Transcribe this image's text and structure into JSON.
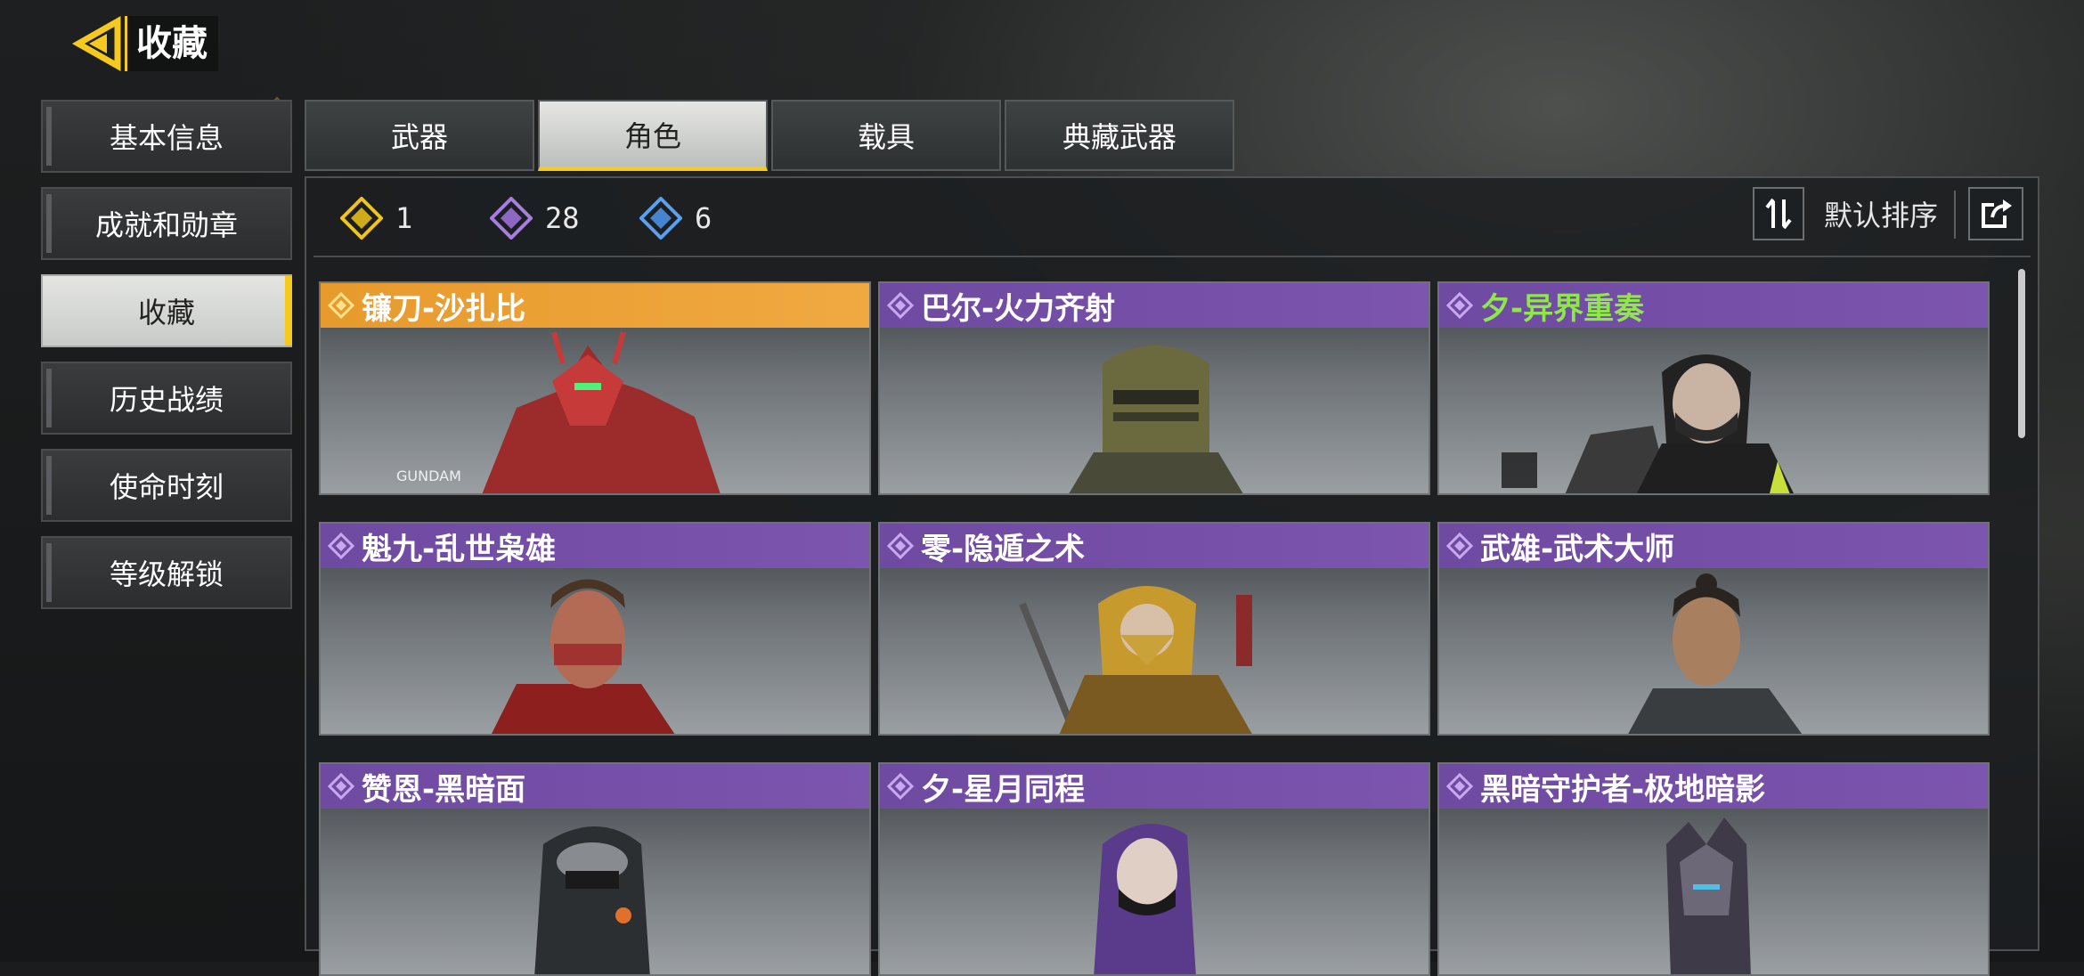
{
  "header": {
    "title": "收藏"
  },
  "sidebar": {
    "items": [
      {
        "label": "基本信息"
      },
      {
        "label": "成就和勋章"
      },
      {
        "label": "收藏"
      },
      {
        "label": "历史战绩"
      },
      {
        "label": "使命时刻"
      },
      {
        "label": "等级解锁"
      }
    ],
    "active_index": 2
  },
  "tabs": [
    {
      "label": "武器"
    },
    {
      "label": "角色"
    },
    {
      "label": "载具"
    },
    {
      "label": "典藏武器"
    }
  ],
  "active_tab": 1,
  "rarity_counts": [
    {
      "icon": "gold-diamond-icon",
      "color": "#f0c419",
      "count": "1"
    },
    {
      "icon": "purple-diamond-icon",
      "color": "#9b6fd6",
      "count": "28"
    },
    {
      "icon": "blue-diamond-icon",
      "color": "#4a90e2",
      "count": "6"
    }
  ],
  "sort": {
    "label": "默认排序"
  },
  "characters": [
    {
      "name": "镰刀-沙扎比",
      "rarity": "legendary",
      "header_color": "#e89a2c",
      "name_color": "#ffffff"
    },
    {
      "name": "巴尔-火力齐射",
      "rarity": "epic",
      "header_color": "#6f4aa1",
      "name_color": "#ffffff"
    },
    {
      "name": "夕-异界重奏",
      "rarity": "epic",
      "header_color": "#6f4aa1",
      "name_color": "#8fe84a"
    },
    {
      "name": "魁九-乱世枭雄",
      "rarity": "epic",
      "header_color": "#6f4aa1",
      "name_color": "#ffffff"
    },
    {
      "name": "零-隐遁之术",
      "rarity": "epic",
      "header_color": "#6f4aa1",
      "name_color": "#ffffff"
    },
    {
      "name": "武雄-武术大师",
      "rarity": "epic",
      "header_color": "#6f4aa1",
      "name_color": "#ffffff"
    },
    {
      "name": "赞恩-黑暗面",
      "rarity": "epic",
      "header_color": "#6f4aa1",
      "name_color": "#ffffff"
    },
    {
      "name": "夕-星月同程",
      "rarity": "epic",
      "header_color": "#6f4aa1",
      "name_color": "#ffffff"
    },
    {
      "name": "黑暗守护者-极地暗影",
      "rarity": "epic",
      "header_color": "#6f4aa1",
      "name_color": "#ffffff"
    }
  ]
}
